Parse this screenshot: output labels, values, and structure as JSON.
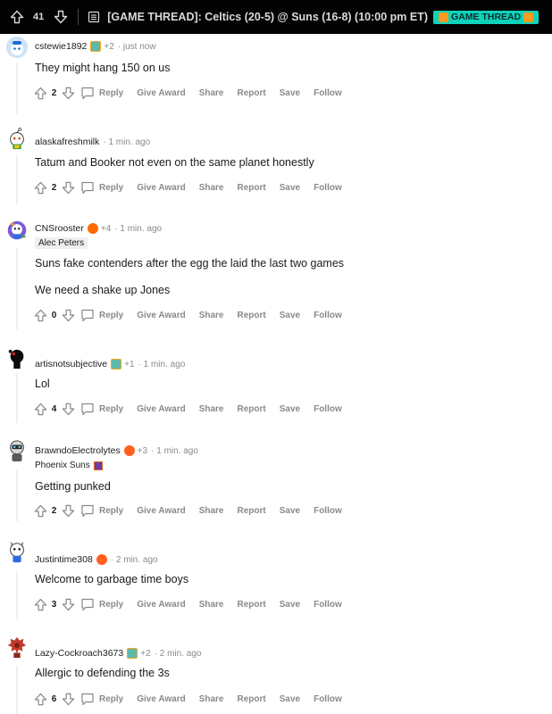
{
  "header": {
    "vote_count": "41",
    "title": "[GAME THREAD]: Celtics (20-5) @ Suns (16-8) (10:00 pm ET)",
    "flair": "GAME THREAD"
  },
  "actions": {
    "reply": "Reply",
    "give_award": "Give Award",
    "share": "Share",
    "report": "Report",
    "save": "Save",
    "follow": "Follow"
  },
  "comments": [
    {
      "user": "cstewie1892",
      "award_count": "+2",
      "time": "just now",
      "flair": "",
      "lines": [
        "They might hang 150 on us"
      ],
      "votes": "2"
    },
    {
      "user": "alaskafreshmilk",
      "award_count": "",
      "time": "1 min. ago",
      "flair": "",
      "lines": [
        "Tatum and Booker not even on the same planet honestly"
      ],
      "votes": "2"
    },
    {
      "user": "CNSrooster",
      "award_count": "+4",
      "time": "1 min. ago",
      "flair": "Alec Peters",
      "lines": [
        "Suns fake contenders after the egg the laid the last two games",
        "We need a shake up Jones"
      ],
      "votes": "0"
    },
    {
      "user": "artisnotsubjective",
      "award_count": "+1",
      "time": "1 min. ago",
      "flair": "",
      "lines": [
        "Lol"
      ],
      "votes": "4"
    },
    {
      "user": "BrawndoElectrolytes",
      "award_count": "+3",
      "time": "1 min. ago",
      "flair": "Phoenix Suns",
      "lines": [
        "Getting punked"
      ],
      "votes": "2"
    },
    {
      "user": "Justintime308",
      "award_count": "",
      "time": "2 min. ago",
      "flair": "",
      "lines": [
        "Welcome to garbage time boys"
      ],
      "votes": "3"
    },
    {
      "user": "Lazy-Cockroach3673",
      "award_count": "+2",
      "time": "2 min. ago",
      "flair": "",
      "lines": [
        "Allergic to defending the 3s"
      ],
      "votes": "6"
    }
  ],
  "colors": {
    "topbar_bg": "#030303",
    "flair_bg": "#0dd3bb",
    "muted_text": "#878a8c",
    "thread_line": "#edeff1"
  }
}
